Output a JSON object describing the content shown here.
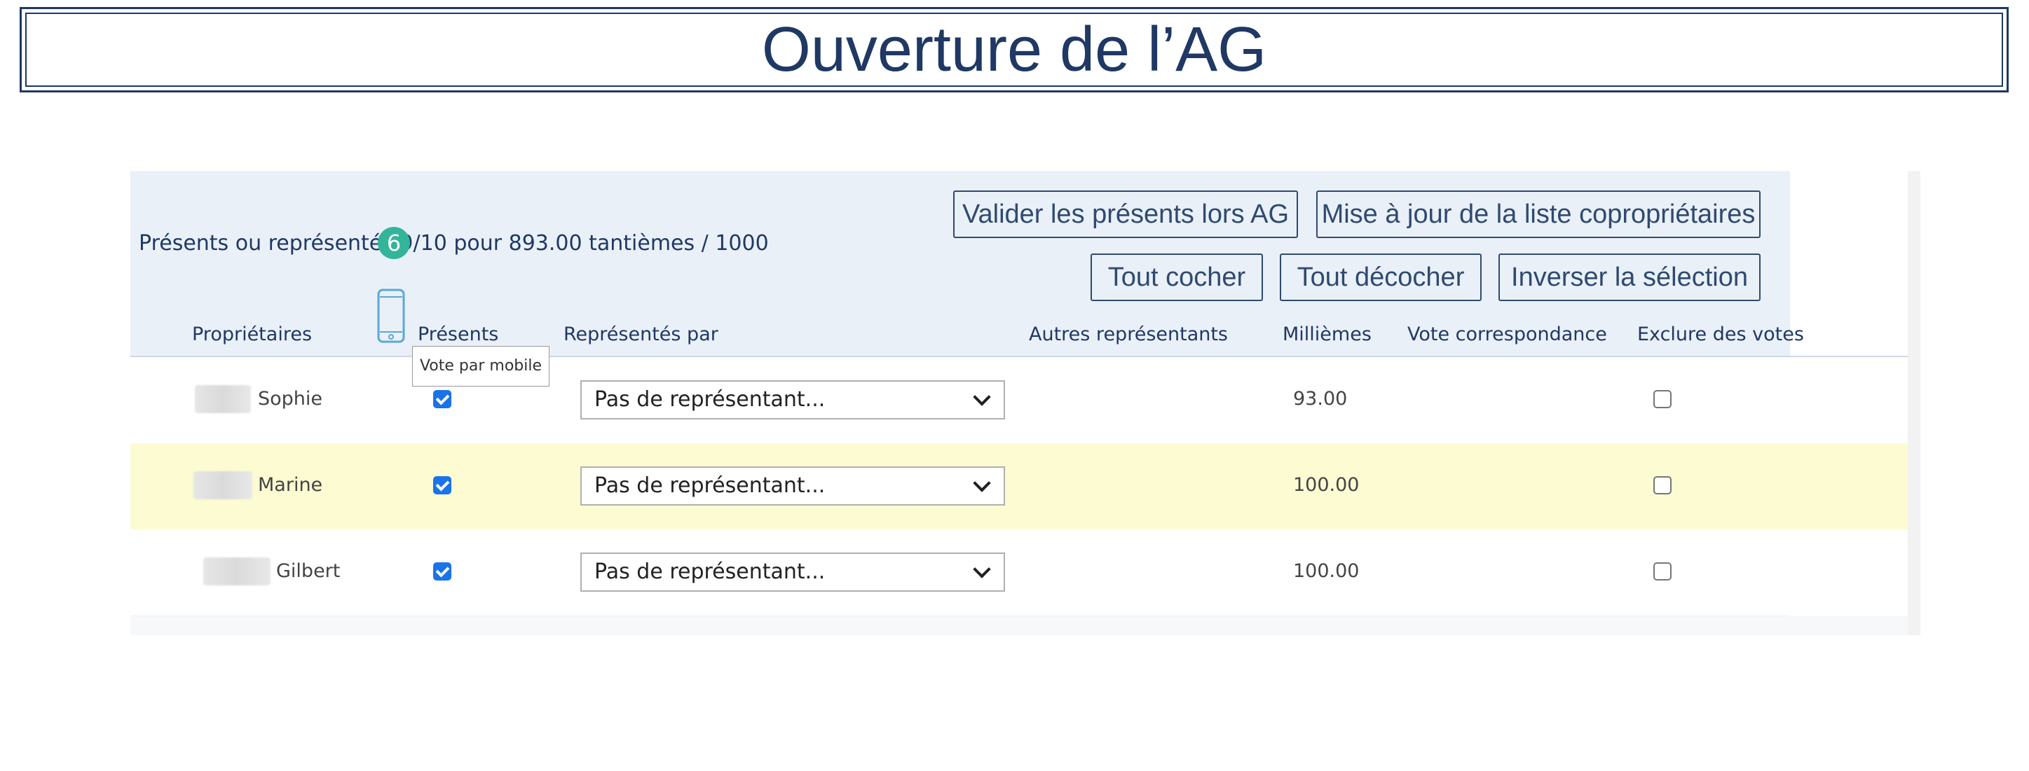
{
  "slide": {
    "title": "Ouverture de l’AG"
  },
  "summary": "Présents ou représentés 9/10 pour 893.00 tantièmes / 1000",
  "buttons": {
    "validate": "Valider les présents lors AG",
    "update_list": "Mise à jour de la liste copropriétaires",
    "check_all": "Tout cocher",
    "uncheck_all": "Tout décocher",
    "invert": "Inverser la sélection"
  },
  "columns": {
    "owners": "Propriétaires",
    "present": "Présents",
    "represented_by": "Représentés par",
    "other_reps": "Autres représentants",
    "thousandths": "Millièmes",
    "mail_vote": "Vote correspondance",
    "exclude": "Exclure des votes"
  },
  "rows": [
    {
      "name": "Sophie",
      "present": true,
      "representative": "Pas de représentant...",
      "thousandths": "93.00",
      "excluded": false
    },
    {
      "name": "Marine",
      "present": true,
      "representative": "Pas de représentant...",
      "thousandths": "100.00",
      "excluded": false
    },
    {
      "name": "Gilbert",
      "present": true,
      "representative": "Pas de représentant...",
      "thousandths": "100.00",
      "excluded": false
    }
  ],
  "callout": {
    "number": "6"
  },
  "tooltip": {
    "text": "Vote par mobile"
  },
  "colors": {
    "title": "#1f3864",
    "panel": "#eaf0f8",
    "highlight_row": "#fdfbd2",
    "badge": "#33b59a",
    "checkbox": "#1a73e8"
  },
  "icons": [
    "mobile-phone-icon",
    "chevron-down-icon",
    "checkbox-checked-icon",
    "checkbox-empty-icon"
  ]
}
